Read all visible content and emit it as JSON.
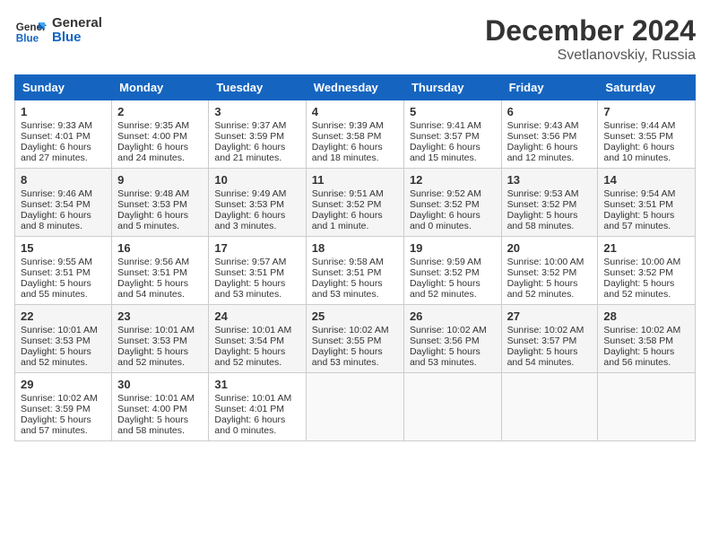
{
  "logo": {
    "text_general": "General",
    "text_blue": "Blue"
  },
  "title": {
    "month_year": "December 2024",
    "location": "Svetlanovskiy, Russia"
  },
  "headers": [
    "Sunday",
    "Monday",
    "Tuesday",
    "Wednesday",
    "Thursday",
    "Friday",
    "Saturday"
  ],
  "weeks": [
    [
      {
        "day": "1",
        "sunrise": "9:33 AM",
        "sunset": "4:01 PM",
        "daylight": "6 hours and 27 minutes."
      },
      {
        "day": "2",
        "sunrise": "9:35 AM",
        "sunset": "4:00 PM",
        "daylight": "6 hours and 24 minutes."
      },
      {
        "day": "3",
        "sunrise": "9:37 AM",
        "sunset": "3:59 PM",
        "daylight": "6 hours and 21 minutes."
      },
      {
        "day": "4",
        "sunrise": "9:39 AM",
        "sunset": "3:58 PM",
        "daylight": "6 hours and 18 minutes."
      },
      {
        "day": "5",
        "sunrise": "9:41 AM",
        "sunset": "3:57 PM",
        "daylight": "6 hours and 15 minutes."
      },
      {
        "day": "6",
        "sunrise": "9:43 AM",
        "sunset": "3:56 PM",
        "daylight": "6 hours and 12 minutes."
      },
      {
        "day": "7",
        "sunrise": "9:44 AM",
        "sunset": "3:55 PM",
        "daylight": "6 hours and 10 minutes."
      }
    ],
    [
      {
        "day": "8",
        "sunrise": "9:46 AM",
        "sunset": "3:54 PM",
        "daylight": "6 hours and 8 minutes."
      },
      {
        "day": "9",
        "sunrise": "9:48 AM",
        "sunset": "3:53 PM",
        "daylight": "6 hours and 5 minutes."
      },
      {
        "day": "10",
        "sunrise": "9:49 AM",
        "sunset": "3:53 PM",
        "daylight": "6 hours and 3 minutes."
      },
      {
        "day": "11",
        "sunrise": "9:51 AM",
        "sunset": "3:52 PM",
        "daylight": "6 hours and 1 minute."
      },
      {
        "day": "12",
        "sunrise": "9:52 AM",
        "sunset": "3:52 PM",
        "daylight": "6 hours and 0 minutes."
      },
      {
        "day": "13",
        "sunrise": "9:53 AM",
        "sunset": "3:52 PM",
        "daylight": "5 hours and 58 minutes."
      },
      {
        "day": "14",
        "sunrise": "9:54 AM",
        "sunset": "3:51 PM",
        "daylight": "5 hours and 57 minutes."
      }
    ],
    [
      {
        "day": "15",
        "sunrise": "9:55 AM",
        "sunset": "3:51 PM",
        "daylight": "5 hours and 55 minutes."
      },
      {
        "day": "16",
        "sunrise": "9:56 AM",
        "sunset": "3:51 PM",
        "daylight": "5 hours and 54 minutes."
      },
      {
        "day": "17",
        "sunrise": "9:57 AM",
        "sunset": "3:51 PM",
        "daylight": "5 hours and 53 minutes."
      },
      {
        "day": "18",
        "sunrise": "9:58 AM",
        "sunset": "3:51 PM",
        "daylight": "5 hours and 53 minutes."
      },
      {
        "day": "19",
        "sunrise": "9:59 AM",
        "sunset": "3:52 PM",
        "daylight": "5 hours and 52 minutes."
      },
      {
        "day": "20",
        "sunrise": "10:00 AM",
        "sunset": "3:52 PM",
        "daylight": "5 hours and 52 minutes."
      },
      {
        "day": "21",
        "sunrise": "10:00 AM",
        "sunset": "3:52 PM",
        "daylight": "5 hours and 52 minutes."
      }
    ],
    [
      {
        "day": "22",
        "sunrise": "10:01 AM",
        "sunset": "3:53 PM",
        "daylight": "5 hours and 52 minutes."
      },
      {
        "day": "23",
        "sunrise": "10:01 AM",
        "sunset": "3:53 PM",
        "daylight": "5 hours and 52 minutes."
      },
      {
        "day": "24",
        "sunrise": "10:01 AM",
        "sunset": "3:54 PM",
        "daylight": "5 hours and 52 minutes."
      },
      {
        "day": "25",
        "sunrise": "10:02 AM",
        "sunset": "3:55 PM",
        "daylight": "5 hours and 53 minutes."
      },
      {
        "day": "26",
        "sunrise": "10:02 AM",
        "sunset": "3:56 PM",
        "daylight": "5 hours and 53 minutes."
      },
      {
        "day": "27",
        "sunrise": "10:02 AM",
        "sunset": "3:57 PM",
        "daylight": "5 hours and 54 minutes."
      },
      {
        "day": "28",
        "sunrise": "10:02 AM",
        "sunset": "3:58 PM",
        "daylight": "5 hours and 56 minutes."
      }
    ],
    [
      {
        "day": "29",
        "sunrise": "10:02 AM",
        "sunset": "3:59 PM",
        "daylight": "5 hours and 57 minutes."
      },
      {
        "day": "30",
        "sunrise": "10:01 AM",
        "sunset": "4:00 PM",
        "daylight": "5 hours and 58 minutes."
      },
      {
        "day": "31",
        "sunrise": "10:01 AM",
        "sunset": "4:01 PM",
        "daylight": "6 hours and 0 minutes."
      },
      null,
      null,
      null,
      null
    ]
  ],
  "labels": {
    "sunrise_prefix": "Sunrise: ",
    "sunset_prefix": "Sunset: ",
    "daylight_prefix": "Daylight: "
  }
}
